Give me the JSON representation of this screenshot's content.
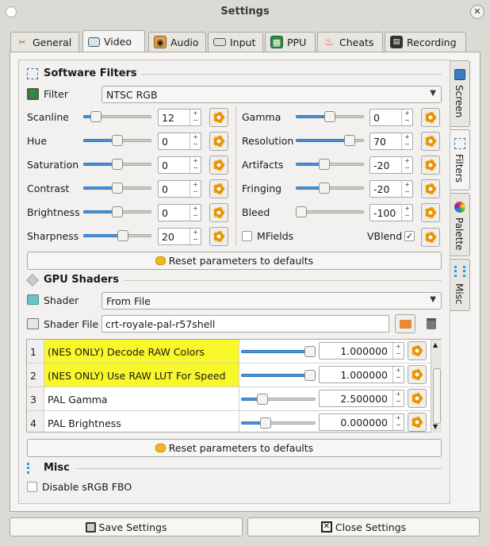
{
  "window": {
    "title": "Settings"
  },
  "tabs": [
    {
      "label": "General",
      "icon": "tools-icon"
    },
    {
      "label": "Video",
      "icon": "monitor-icon"
    },
    {
      "label": "Audio",
      "icon": "speaker-icon"
    },
    {
      "label": "Input",
      "icon": "keyboard-icon"
    },
    {
      "label": "PPU",
      "icon": "chip-icon"
    },
    {
      "label": "Cheats",
      "icon": "flame-icon"
    },
    {
      "label": "Recording",
      "icon": "clapper-icon"
    }
  ],
  "side_tabs": [
    {
      "label": "Screen",
      "icon": "screen-icon"
    },
    {
      "label": "Filters",
      "icon": "filter-icon"
    },
    {
      "label": "Palette",
      "icon": "palette-icon"
    },
    {
      "label": "Misc",
      "icon": "misc-icon"
    }
  ],
  "software_filters": {
    "heading": "Software Filters",
    "filter_label": "Filter",
    "filter_value": "NTSC RGB",
    "left": [
      {
        "label": "Scanline",
        "value": "12",
        "level": 0.12
      },
      {
        "label": "Hue",
        "value": "0",
        "level": 0.5
      },
      {
        "label": "Saturation",
        "value": "0",
        "level": 0.5
      },
      {
        "label": "Contrast",
        "value": "0",
        "level": 0.5
      },
      {
        "label": "Brightness",
        "value": "0",
        "level": 0.5
      },
      {
        "label": "Sharpness",
        "value": "20",
        "level": 0.6
      }
    ],
    "right": [
      {
        "label": "Gamma",
        "value": "0",
        "level": 0.5
      },
      {
        "label": "Resolution",
        "value": "70",
        "level": 0.85
      },
      {
        "label": "Artifacts",
        "value": "-20",
        "level": 0.4
      },
      {
        "label": "Fringing",
        "value": "-20",
        "level": 0.4
      },
      {
        "label": "Bleed",
        "value": "-100",
        "level": 0.0
      }
    ],
    "mfields_label": "MFields",
    "vblend_label": "VBlend",
    "vblend_check": "✓",
    "reset_label": "Reset parameters to defaults"
  },
  "gpu_shaders": {
    "heading": "GPU Shaders",
    "shader_label": "Shader",
    "shader_value": "From File",
    "file_label": "Shader File",
    "file_value": "crt-royale-pal-r57shell",
    "rows": [
      {
        "index": "1",
        "name": "(NES ONLY) Decode RAW Colors",
        "value": "1.000000",
        "level": 1.0,
        "highlight": "#f7f72a"
      },
      {
        "index": "2",
        "name": "(NES ONLY) Use RAW LUT For Speed",
        "value": "1.000000",
        "level": 1.0,
        "highlight": "#f7f72a"
      },
      {
        "index": "3",
        "name": "PAL Gamma",
        "value": "2.500000",
        "level": 0.25,
        "highlight": ""
      },
      {
        "index": "4",
        "name": "PAL Brightness",
        "value": "0.000000",
        "level": 0.3,
        "highlight": ""
      }
    ],
    "reset_label": "Reset parameters to defaults"
  },
  "misc": {
    "heading": "Misc",
    "disable_srgb_label": "Disable sRGB FBO"
  },
  "footer": {
    "save_label": "Save Settings",
    "close_label": "Close Settings"
  },
  "colors": {
    "accent": "#4b92d8",
    "highlight": "#f7f72a"
  }
}
